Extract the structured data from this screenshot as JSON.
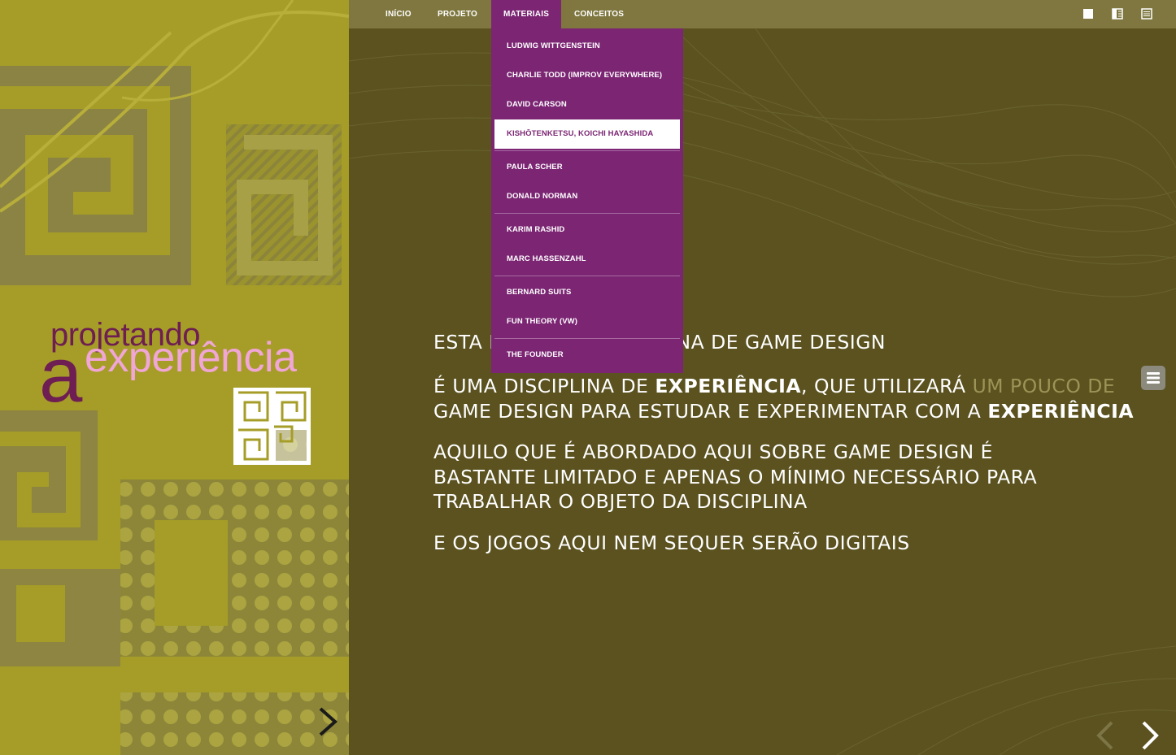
{
  "nav": {
    "items": [
      "INÍCIO",
      "PROJETO",
      "MATERIAIS",
      "CONCEITOS"
    ],
    "active": "MATERIAIS"
  },
  "view_icons": [
    "single-page-icon",
    "split-page-icon",
    "list-view-icon"
  ],
  "dropdown": {
    "items": [
      "LUDWIG WITTGENSTEIN",
      "CHARLIE TODD (IMPROV EVERYWHERE)",
      "DAVID CARSON",
      "KISHŌTENKETSU, KOICHI HAYASHIDA",
      "PAULA SCHER",
      "DONALD NORMAN",
      "KARIM RASHID",
      "MARC HASSENZAHL",
      "BERNARD SUITS",
      "FUN THEORY (VW)",
      "THE FOUNDER"
    ],
    "highlighted": "KISHŌTENKETSU, KOICHI HAYASHIDA"
  },
  "logo": {
    "line1": "projetando",
    "letter": "a",
    "line2": "experiência"
  },
  "content": {
    "line1_a": "ESTA ",
    "line1_b": "N",
    "line1_c": "NA DE GAME DESIGN",
    "p2_l1_a": "É UMA DISCIPLINA DE ",
    "p2_l1_b": "EXPERIÊNCIA",
    "p2_l1_c": ", QUE UTILIZARÁ ",
    "p2_l1_d": "UM POUCO DE",
    "p2_l2_a": "GAME DESIGN PARA ESTUDAR E EXPERIMENTAR COM A ",
    "p2_l2_b": "EXPERIÊNCIA",
    "p3_l1": "AQUILO QUE É ABORDADO AQUI SOBRE GAME DESIGN É",
    "p3_l2": "BASTANTE LIMITADO E APENAS O MÍNIMO NECESSÁRIO PARA",
    "p3_l3": "TRABALHAR O OBJETO DA DISCIPLINA",
    "p4_l1": "E OS JOGOS AQUI NEM SEQUER SERÃO DIGITAIS"
  },
  "colors": {
    "left_bg": "#a59d27",
    "main_bg": "#5b5220",
    "topbar": "#7f773f",
    "accent_purple": "#7b2573",
    "logo_pink": "#f0a6d6",
    "logo_purple": "#6e1e52"
  }
}
